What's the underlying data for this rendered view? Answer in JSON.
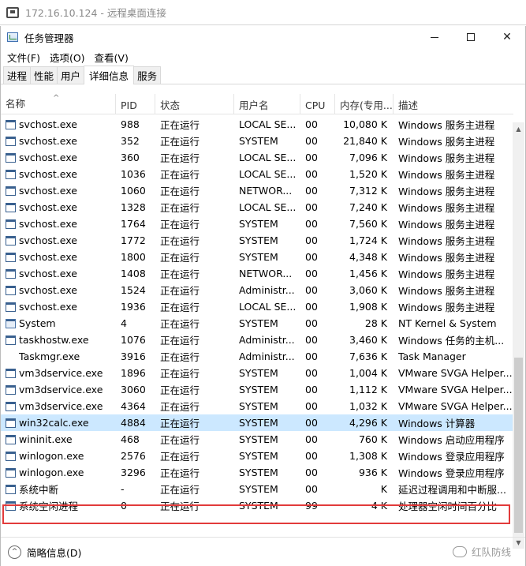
{
  "rdp": {
    "title": "172.16.10.124 - 远程桌面连接"
  },
  "window": {
    "title": "任务管理器",
    "minimize_glyph": "—",
    "maximize_glyph": "☐",
    "close_glyph": "✕"
  },
  "menu": {
    "file": "文件(F)",
    "options": "选项(O)",
    "view": "查看(V)"
  },
  "tabs": {
    "processes": "进程",
    "performance": "性能",
    "users": "用户",
    "details": "详细信息",
    "services": "服务"
  },
  "columns": {
    "name": "名称",
    "pid": "PID",
    "status": "状态",
    "user": "用户名",
    "cpu": "CPU",
    "mem": "内存(专用...",
    "desc": "描述"
  },
  "rows": [
    {
      "name": "svchost.exe",
      "pid": "988",
      "status": "正在运行",
      "user": "LOCAL SE...",
      "cpu": "00",
      "mem": "10,080 K",
      "desc": "Windows 服务主进程",
      "icon": "service-icon"
    },
    {
      "name": "svchost.exe",
      "pid": "352",
      "status": "正在运行",
      "user": "SYSTEM",
      "cpu": "00",
      "mem": "21,840 K",
      "desc": "Windows 服务主进程",
      "icon": "service-icon"
    },
    {
      "name": "svchost.exe",
      "pid": "360",
      "status": "正在运行",
      "user": "LOCAL SE...",
      "cpu": "00",
      "mem": "7,096 K",
      "desc": "Windows 服务主进程",
      "icon": "service-icon"
    },
    {
      "name": "svchost.exe",
      "pid": "1036",
      "status": "正在运行",
      "user": "LOCAL SE...",
      "cpu": "00",
      "mem": "1,520 K",
      "desc": "Windows 服务主进程",
      "icon": "service-icon"
    },
    {
      "name": "svchost.exe",
      "pid": "1060",
      "status": "正在运行",
      "user": "NETWOR...",
      "cpu": "00",
      "mem": "7,312 K",
      "desc": "Windows 服务主进程",
      "icon": "service-icon"
    },
    {
      "name": "svchost.exe",
      "pid": "1328",
      "status": "正在运行",
      "user": "LOCAL SE...",
      "cpu": "00",
      "mem": "7,240 K",
      "desc": "Windows 服务主进程",
      "icon": "service-icon"
    },
    {
      "name": "svchost.exe",
      "pid": "1764",
      "status": "正在运行",
      "user": "SYSTEM",
      "cpu": "00",
      "mem": "7,560 K",
      "desc": "Windows 服务主进程",
      "icon": "service-icon"
    },
    {
      "name": "svchost.exe",
      "pid": "1772",
      "status": "正在运行",
      "user": "SYSTEM",
      "cpu": "00",
      "mem": "1,724 K",
      "desc": "Windows 服务主进程",
      "icon": "service-icon"
    },
    {
      "name": "svchost.exe",
      "pid": "1800",
      "status": "正在运行",
      "user": "SYSTEM",
      "cpu": "00",
      "mem": "4,348 K",
      "desc": "Windows 服务主进程",
      "icon": "service-icon"
    },
    {
      "name": "svchost.exe",
      "pid": "1408",
      "status": "正在运行",
      "user": "NETWOR...",
      "cpu": "00",
      "mem": "1,456 K",
      "desc": "Windows 服务主进程",
      "icon": "service-icon"
    },
    {
      "name": "svchost.exe",
      "pid": "1524",
      "status": "正在运行",
      "user": "Administr...",
      "cpu": "00",
      "mem": "3,060 K",
      "desc": "Windows 服务主进程",
      "icon": "service-icon"
    },
    {
      "name": "svchost.exe",
      "pid": "1936",
      "status": "正在运行",
      "user": "LOCAL SE...",
      "cpu": "00",
      "mem": "1,908 K",
      "desc": "Windows 服务主进程",
      "icon": "service-icon"
    },
    {
      "name": "System",
      "pid": "4",
      "status": "正在运行",
      "user": "SYSTEM",
      "cpu": "00",
      "mem": "28 K",
      "desc": "NT Kernel & System",
      "icon": "system-icon"
    },
    {
      "name": "taskhostw.exe",
      "pid": "1076",
      "status": "正在运行",
      "user": "Administr...",
      "cpu": "00",
      "mem": "3,460 K",
      "desc": "Windows 任务的主机...",
      "icon": "app-icon"
    },
    {
      "name": "Taskmgr.exe",
      "pid": "3916",
      "status": "正在运行",
      "user": "Administr...",
      "cpu": "00",
      "mem": "7,636 K",
      "desc": "Task Manager",
      "icon": "taskmgr-icon"
    },
    {
      "name": "vm3dservice.exe",
      "pid": "1896",
      "status": "正在运行",
      "user": "SYSTEM",
      "cpu": "00",
      "mem": "1,004 K",
      "desc": "VMware SVGA Helper...",
      "icon": "app-icon"
    },
    {
      "name": "vm3dservice.exe",
      "pid": "3060",
      "status": "正在运行",
      "user": "SYSTEM",
      "cpu": "00",
      "mem": "1,112 K",
      "desc": "VMware SVGA Helper...",
      "icon": "app-icon"
    },
    {
      "name": "vm3dservice.exe",
      "pid": "4364",
      "status": "正在运行",
      "user": "SYSTEM",
      "cpu": "00",
      "mem": "1,032 K",
      "desc": "VMware SVGA Helper...",
      "icon": "app-icon"
    },
    {
      "name": "win32calc.exe",
      "pid": "4884",
      "status": "正在运行",
      "user": "SYSTEM",
      "cpu": "00",
      "mem": "4,296 K",
      "desc": "Windows 计算器",
      "icon": "calculator-icon",
      "selected": true
    },
    {
      "name": "wininit.exe",
      "pid": "468",
      "status": "正在运行",
      "user": "SYSTEM",
      "cpu": "00",
      "mem": "760 K",
      "desc": "Windows 启动应用程序",
      "icon": "app-icon"
    },
    {
      "name": "winlogon.exe",
      "pid": "2576",
      "status": "正在运行",
      "user": "SYSTEM",
      "cpu": "00",
      "mem": "1,308 K",
      "desc": "Windows 登录应用程序",
      "icon": "app-icon"
    },
    {
      "name": "winlogon.exe",
      "pid": "3296",
      "status": "正在运行",
      "user": "SYSTEM",
      "cpu": "00",
      "mem": "936 K",
      "desc": "Windows 登录应用程序",
      "icon": "app-icon"
    },
    {
      "name": "系统中断",
      "pid": "-",
      "status": "正在运行",
      "user": "SYSTEM",
      "cpu": "00",
      "mem": "K",
      "desc": "延迟过程调用和中断服...",
      "icon": "app-icon"
    },
    {
      "name": "系统空闲进程",
      "pid": "0",
      "status": "正在运行",
      "user": "SYSTEM",
      "cpu": "99",
      "mem": "4 K",
      "desc": "处理器空闲时间百分比",
      "icon": "app-icon"
    }
  ],
  "footer": {
    "fewer_details": "简略信息(D)",
    "watermark": "红队防线"
  },
  "colors": {
    "selection": "#cce8ff",
    "highlight_border": "#e23b3b"
  }
}
